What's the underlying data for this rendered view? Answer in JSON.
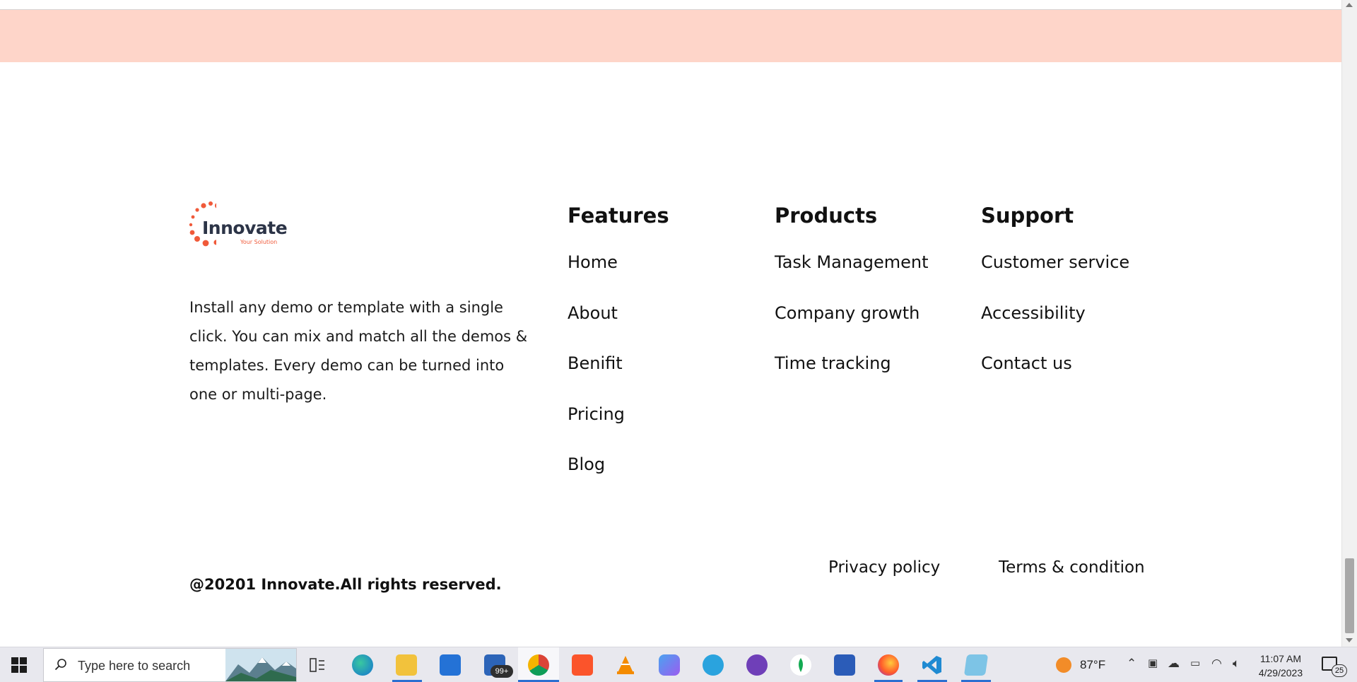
{
  "footer": {
    "logo": {
      "name": "Innovate",
      "tagline": "Your Solution"
    },
    "about": "Install any demo or template with a single click. You can mix and match all the demos & templates. Every demo can be turned into one or multi-page.",
    "columns": [
      {
        "heading": "Features",
        "links": [
          "Home",
          "About",
          "Benifit",
          "Pricing",
          "Blog"
        ]
      },
      {
        "heading": "Products",
        "links": [
          "Task Management",
          "Company growth",
          "Time tracking"
        ]
      },
      {
        "heading": "Support",
        "links": [
          "Customer service",
          "Accessibility",
          "Contact us"
        ]
      }
    ],
    "copyright": "@20201 Innovate.All rights reserved.",
    "legal": {
      "privacy": "Privacy policy",
      "terms": "Terms & condition"
    }
  },
  "colors": {
    "band": "#fed5c9",
    "logo_dots": "#f05a3a",
    "logo_text": "#2c3447",
    "taskbar": "#e8e8ee",
    "taskbar_active": "#2b6fd1"
  },
  "taskbar": {
    "search_placeholder": "Type here to search",
    "mail_badge": "99+",
    "weather_temp": "87°F",
    "time": "11:07 AM",
    "date": "4/29/2023",
    "notification_count": "25",
    "apps": [
      "task-view",
      "edge",
      "file-explorer",
      "microsoft-store",
      "mail",
      "chrome",
      "brave",
      "vlc",
      "copilot",
      "telegram",
      "github-desktop",
      "mongodb-compass",
      "word",
      "firefox",
      "vscode",
      "notepad"
    ]
  }
}
